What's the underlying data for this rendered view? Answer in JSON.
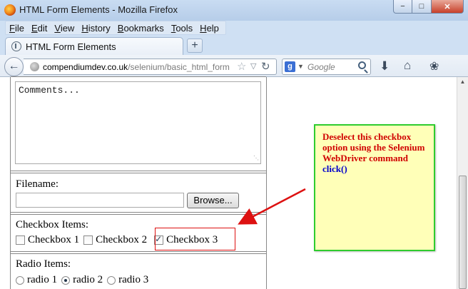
{
  "window": {
    "title": "HTML Form Elements - Mozilla Firefox",
    "minimize": "−",
    "maximize": "□",
    "close": "✕"
  },
  "menu": [
    {
      "u": "F",
      "rest": "ile"
    },
    {
      "u": "E",
      "rest": "dit"
    },
    {
      "u": "V",
      "rest": "iew"
    },
    {
      "u": "H",
      "rest": "istory"
    },
    {
      "u": "B",
      "rest": "ookmarks"
    },
    {
      "u": "T",
      "rest": "ools"
    },
    {
      "u": "H",
      "rest": "elp"
    }
  ],
  "tab": {
    "label": "HTML Form Elements",
    "new_tab": "+"
  },
  "url": {
    "host": "compendiumdev.co.uk",
    "path": "/selenium/basic_html_form"
  },
  "search": {
    "placeholder": "Google",
    "engine_letter": "g"
  },
  "form": {
    "comments_placeholder": "Comments...",
    "filename_label": "Filename:",
    "browse_label": "Browse...",
    "checkbox_label": "Checkbox Items:",
    "checkboxes": [
      {
        "label": "Checkbox 1",
        "checked": false
      },
      {
        "label": "Checkbox 2",
        "checked": false
      },
      {
        "label": "Checkbox 3",
        "checked": true
      }
    ],
    "radio_label": "Radio Items:",
    "radios": [
      {
        "label": "radio 1",
        "checked": false
      },
      {
        "label": "radio 2",
        "checked": true
      },
      {
        "label": "radio 3",
        "checked": false
      }
    ]
  },
  "callout": {
    "text": "Deselect this checkbox option using the Selenium WebDriver command ",
    "command": "click()"
  },
  "colors": {
    "callout_bg": "#ffffb8",
    "callout_border": "#2ecc2e",
    "callout_text": "#d00000",
    "command_text": "#0000cc",
    "annotation_red": "#dd1111"
  }
}
